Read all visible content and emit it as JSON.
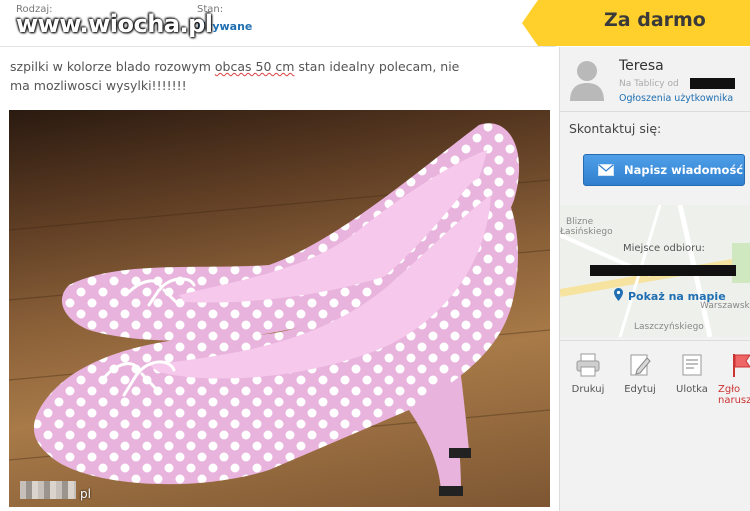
{
  "meta": {
    "type_label": "Rodzaj:",
    "state_label": "Stan:",
    "state_value": "Używane"
  },
  "watermark": "www.wiocha.pl",
  "price": "Za darmo",
  "description": {
    "before": "szpilki w kolorze blado rozowym ",
    "underlined": "obcas 50 cm",
    "after": " stan idealny polecam, nie ma mozliwosci wysylki!!!!!!!"
  },
  "photo": {
    "caption": "pl"
  },
  "user": {
    "name": "Teresa",
    "since_label": "Na Tablicy od",
    "listings_link": "Ogłoszenia użytkownika"
  },
  "contact": {
    "label": "Skontaktuj się:",
    "button": "Napisz wiadomość"
  },
  "map": {
    "street_a": "Blizne",
    "street_b": "Łasińskiego",
    "street_c": "Laszczyńskiego",
    "street_d": "Warszawsk",
    "pickup_label": "Miejsce odbioru:",
    "show_map": "Pokaż na mapie"
  },
  "actions": [
    {
      "label": "Drukuj",
      "icon": "printer-icon"
    },
    {
      "label": "Edytuj",
      "icon": "edit-icon"
    },
    {
      "label": "Ulotka",
      "icon": "flyer-icon"
    },
    {
      "label": "Zgło narusz",
      "icon": "flag-icon"
    }
  ],
  "colors": {
    "price_banner": "#ffd02c",
    "link": "#1f6fb2",
    "button": "#2f7fcf"
  }
}
